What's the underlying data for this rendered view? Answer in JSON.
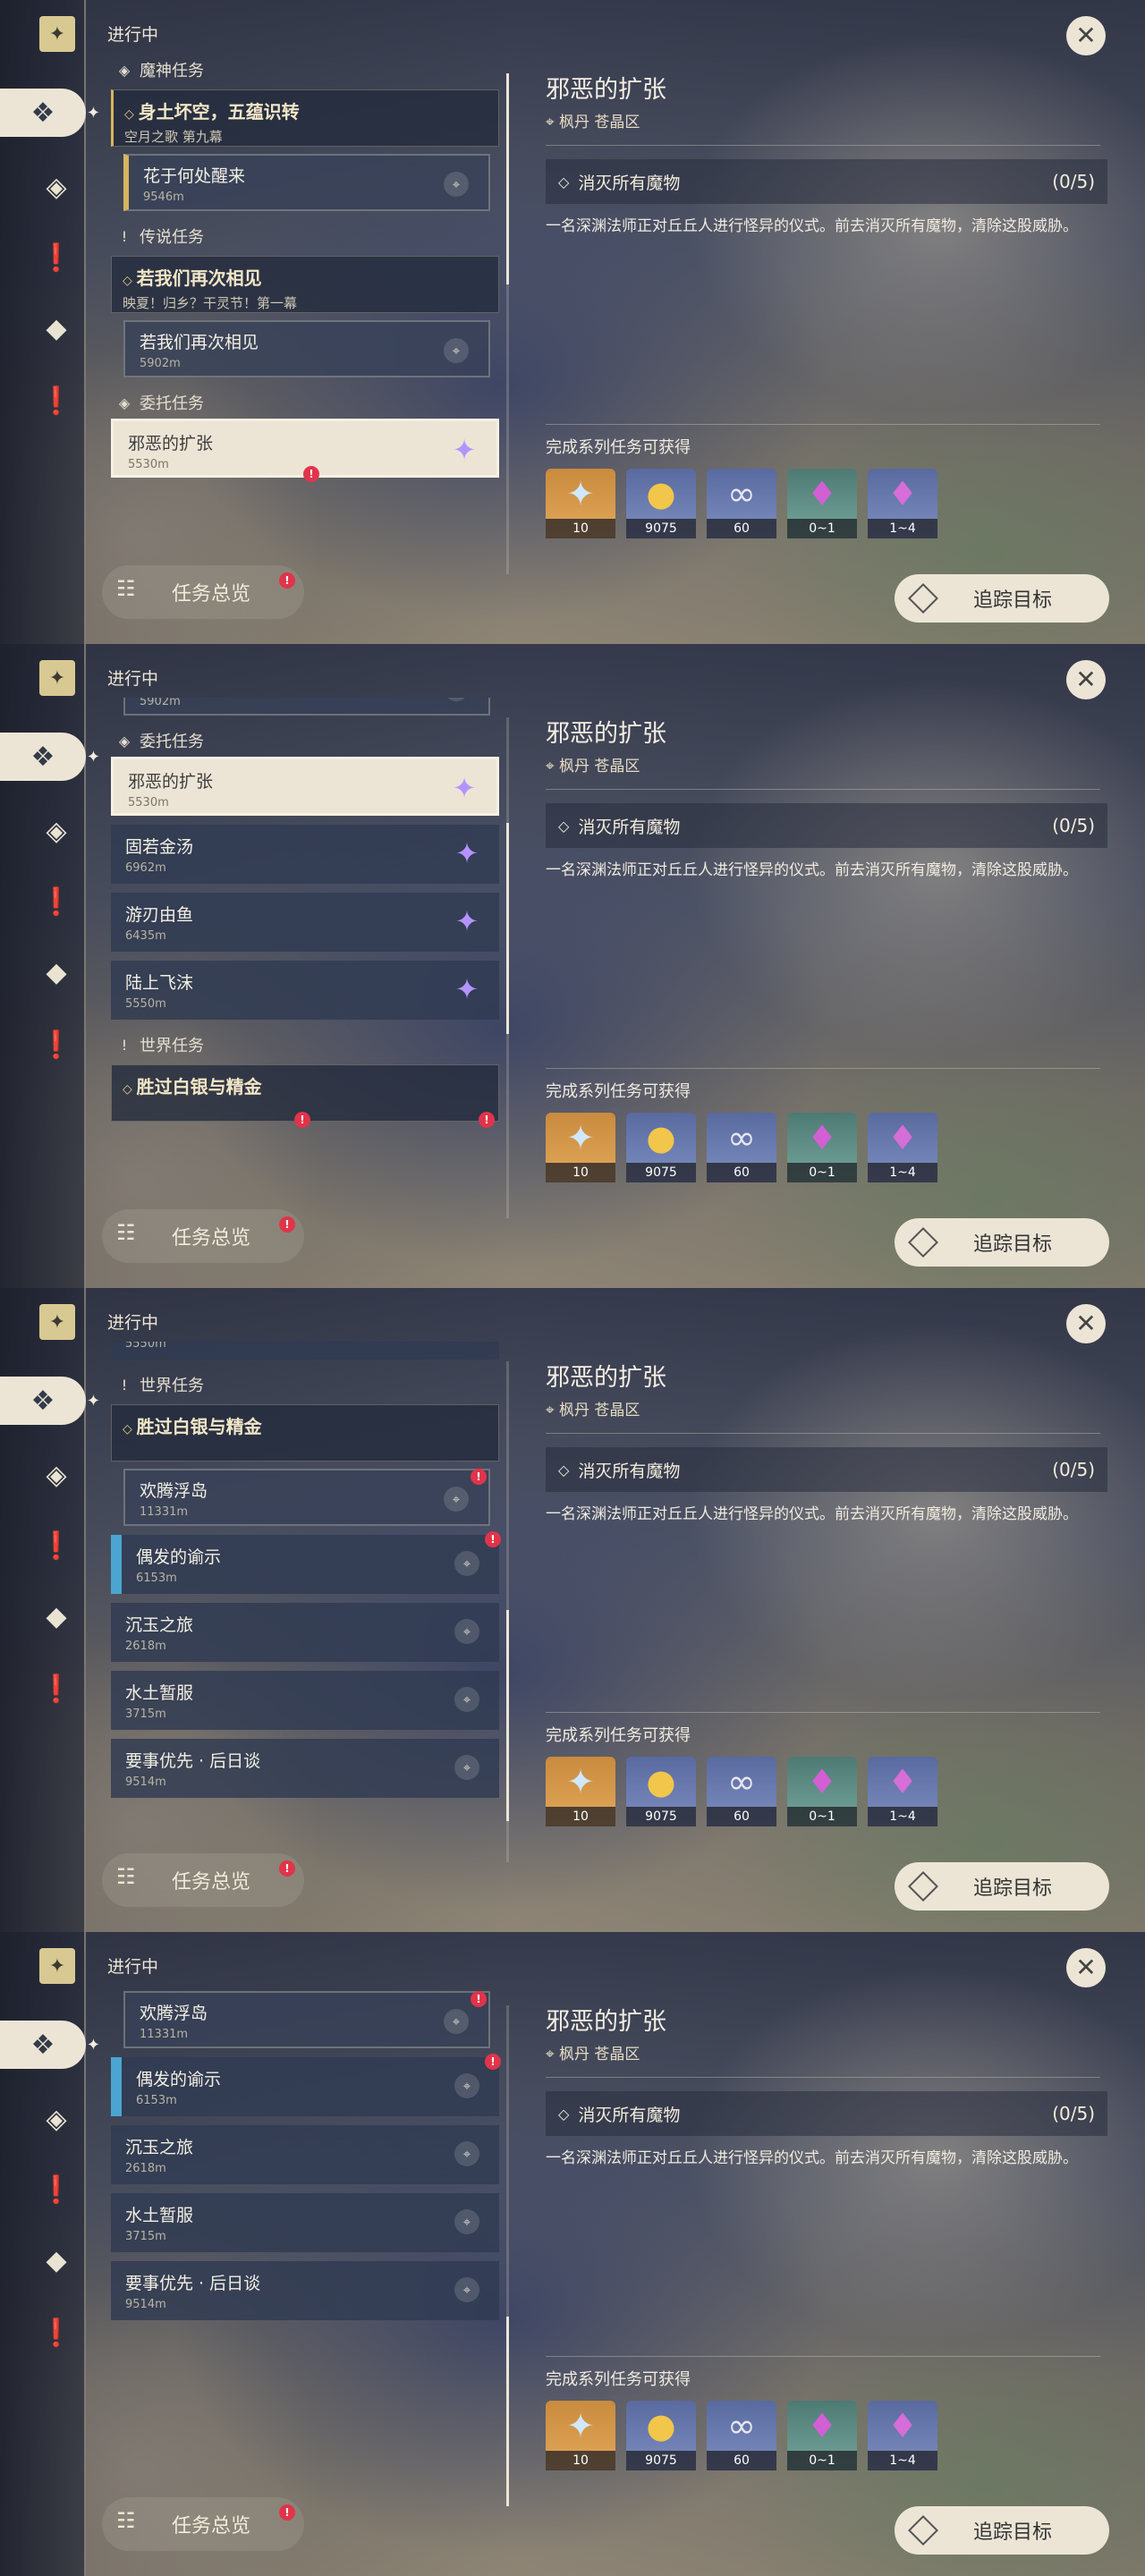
{
  "header": {
    "in_progress": "进行中"
  },
  "buttons": {
    "overview": "任务总览",
    "track": "追踪目标",
    "alert": "!"
  },
  "detail": {
    "title": "邪恶的扩张",
    "location": "枫丹 苍晶区",
    "objective": "消灭所有魔物",
    "progress": "(0/5)",
    "description": "一名深渊法师正对丘丘人进行怪异的仪式。前去消灭所有魔物，清除这股威胁。",
    "rewards_label": "完成系列任务可获得",
    "rewards": [
      {
        "icon": "intertwined-fate-icon",
        "count": "10"
      },
      {
        "icon": "mora-icon",
        "count": "9075"
      },
      {
        "icon": "companionship-exp-icon",
        "count": "60"
      },
      {
        "icon": "crystal-chunk-icon",
        "count": "0~1"
      },
      {
        "icon": "crystal-cluster-icon",
        "count": "1~4"
      }
    ]
  },
  "sections": {
    "archon": "魔神任务",
    "legend": "传说任务",
    "commission": "委托任务",
    "world": "世界任务"
  },
  "quests": {
    "archon_main_title": "身土坏空，五蕴识转",
    "archon_main_sub": "空月之歌 第九幕",
    "archon_sub_name": "花于何处醒来",
    "archon_sub_dist": "9546m",
    "legend_main_title": "若我们再次相见",
    "legend_main_sub": "映夏！归乡？干灵节！第一幕",
    "legend_sub_name": "若我们再次相见",
    "legend_sub_dist": "5902m",
    "c1_name": "邪恶的扩张",
    "c1_dist": "5530m",
    "c2_name": "固若金汤",
    "c2_dist": "6962m",
    "c3_name": "游刃由鱼",
    "c3_dist": "6435m",
    "c4_name": "陆上飞沫",
    "c4_dist": "5550m",
    "world_main_title": "胜过白银与精金",
    "w1_name": "欢腾浮岛",
    "w1_dist": "11331m",
    "w2_name": "偶发的谕示",
    "w2_dist": "6153m",
    "w3_name": "沉玉之旅",
    "w3_dist": "2618m",
    "w4_name": "水土暂服",
    "w4_dist": "3715m",
    "w5_name": "要事优先 · 后日谈",
    "w5_dist": "9514m"
  },
  "colors": {
    "accent": "#ece5d6",
    "gold": "#d8b460",
    "alert": "#e0344a",
    "commission_gem": "#b593ff",
    "world_marker": "#4aa6d0"
  }
}
